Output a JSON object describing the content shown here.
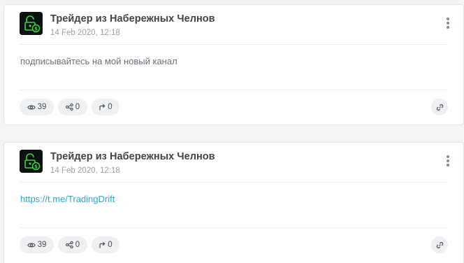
{
  "posts": [
    {
      "author": "Трейдер из Набережных Челнов",
      "date": "14 Feb 2020, 12:18",
      "text": "подписывайтесь на мой новый канал",
      "is_link": false,
      "views": "39",
      "shares": "0",
      "reposts": "0"
    },
    {
      "author": "Трейдер из Набережных Челнов",
      "date": "14 Feb 2020, 12:18",
      "text": "https://t.me/TradingDrift",
      "is_link": true,
      "views": "39",
      "shares": "0",
      "reposts": "0"
    }
  ],
  "icons": {
    "avatar": "lock-dollar-icon",
    "menu": "more-vertical-icon",
    "views": "eye-icon",
    "shares": "share-icon",
    "reposts": "repost-arrow-icon",
    "link": "link-icon"
  },
  "colors": {
    "author": "#3f434a",
    "date": "#9aa0a6",
    "body_text": "#6b717a",
    "link": "#2ea6c7",
    "pill_bg": "#eef0f3",
    "avatar_bg": "#0c120d",
    "avatar_accent": "#3fd14a"
  }
}
